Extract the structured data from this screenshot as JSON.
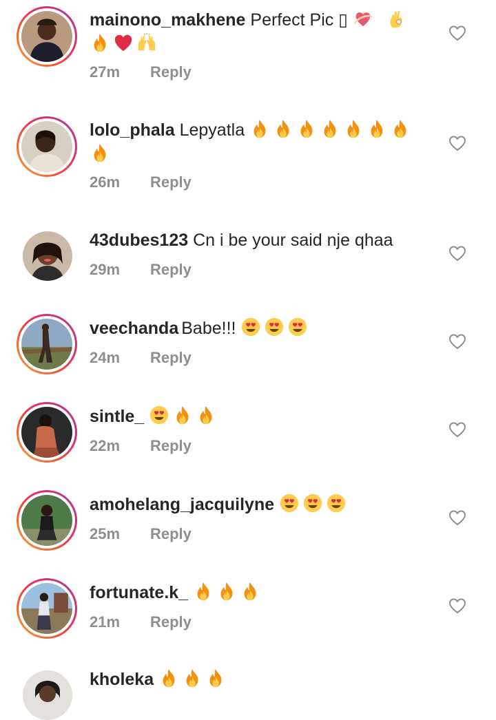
{
  "comments": [
    {
      "username": "mainono_makhene",
      "text": "Perfect Pic ▯",
      "emojis_line1": [
        "sparkle-heart",
        "ok-hand"
      ],
      "emojis_line2": [
        "fire",
        "red-heart",
        "raised-hands"
      ],
      "time": "27m",
      "reply_label": "Reply",
      "story_ring": true
    },
    {
      "username": "lolo_phala",
      "text": "Lepyatla",
      "emojis_line1": [
        "fire",
        "fire",
        "fire",
        "fire",
        "fire",
        "fire",
        "fire"
      ],
      "emojis_line2": [
        "fire"
      ],
      "time": "26m",
      "reply_label": "Reply",
      "story_ring": true
    },
    {
      "username": "43dubes123",
      "text": "Cn i be your said nje qhaa",
      "emojis_line1": [],
      "time": "29m",
      "reply_label": "Reply",
      "story_ring": false
    },
    {
      "username": "veechanda",
      "text": "Babe!!!",
      "emojis_line1": [
        "heart-eyes",
        "heart-eyes",
        "heart-eyes"
      ],
      "time": "24m",
      "reply_label": "Reply",
      "story_ring": true
    },
    {
      "username": "sintle_",
      "text": "",
      "emojis_line1": [
        "heart-eyes",
        "fire",
        "fire"
      ],
      "time": "22m",
      "reply_label": "Reply",
      "story_ring": true
    },
    {
      "username": "amohelang_jacquilyne",
      "text": "",
      "emojis_line1": [
        "heart-eyes",
        "heart-eyes",
        "heart-eyes"
      ],
      "time": "25m",
      "reply_label": "Reply",
      "story_ring": true
    },
    {
      "username": "fortunate.k_",
      "text": "",
      "emojis_line1": [
        "fire",
        "fire",
        "fire"
      ],
      "time": "21m",
      "reply_label": "Reply",
      "story_ring": true
    },
    {
      "username": "kholeka",
      "text": "",
      "emojis_line1": [
        "fire",
        "fire",
        "fire"
      ],
      "story_ring": false
    }
  ],
  "colors": {
    "text": "#262626",
    "meta": "#8e8e8e",
    "story_ring_gradient": [
      "#f9a73f",
      "#e1306c",
      "#b73f9c"
    ]
  },
  "icons": {
    "like": "heart-outline-icon"
  }
}
